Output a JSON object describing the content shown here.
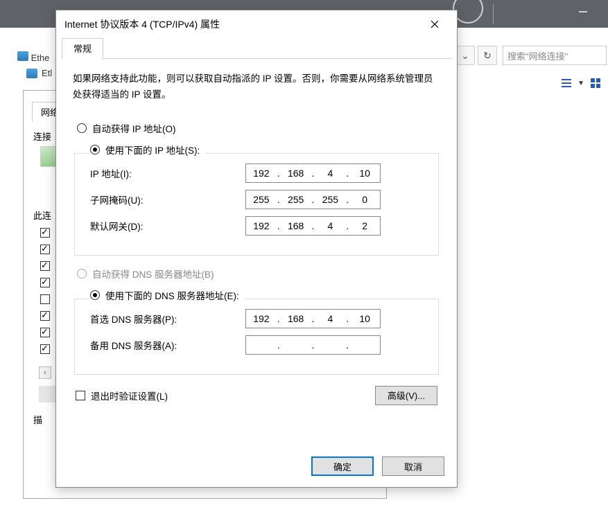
{
  "topbar": {
    "minimize": "—"
  },
  "explorer": {
    "eth1": "Ethe",
    "eth2": "Etl",
    "refresh_tip": "刷新",
    "search_placeholder": "搜索\"网络连接\""
  },
  "props_window": {
    "tab": "网络",
    "connect_label": "连接",
    "uses_label": "此连",
    "checks": [
      true,
      true,
      true,
      true,
      false,
      true,
      true,
      true
    ],
    "desc_label": "描"
  },
  "dialog": {
    "title": "Internet 协议版本 4 (TCP/IPv4) 属性",
    "tab": "常规",
    "description": "如果网络支持此功能，则可以获取自动指派的 IP 设置。否则，你需要从网络系统管理员处获得适当的 IP 设置。",
    "ip_section": {
      "auto_label": "自动获得 IP 地址(O)",
      "manual_label": "使用下面的 IP 地址(S):",
      "selected": "manual",
      "fields": {
        "ip_label": "IP 地址(I):",
        "ip": [
          "192",
          "168",
          "4",
          "10"
        ],
        "mask_label": "子网掩码(U):",
        "mask": [
          "255",
          "255",
          "255",
          "0"
        ],
        "gateway_label": "默认网关(D):",
        "gateway": [
          "192",
          "168",
          "4",
          "2"
        ]
      }
    },
    "dns_section": {
      "auto_label": "自动获得 DNS 服务器地址(B)",
      "manual_label": "使用下面的 DNS 服务器地址(E):",
      "selected": "manual",
      "fields": {
        "pref_label": "首选 DNS 服务器(P):",
        "pref": [
          "192",
          "168",
          "4",
          "10"
        ],
        "alt_label": "备用 DNS 服务器(A):",
        "alt": [
          "",
          "",
          "",
          ""
        ]
      }
    },
    "validate_label": "退出时验证设置(L)",
    "validate_checked": false,
    "advanced": "高级(V)...",
    "ok": "确定",
    "cancel": "取消"
  }
}
